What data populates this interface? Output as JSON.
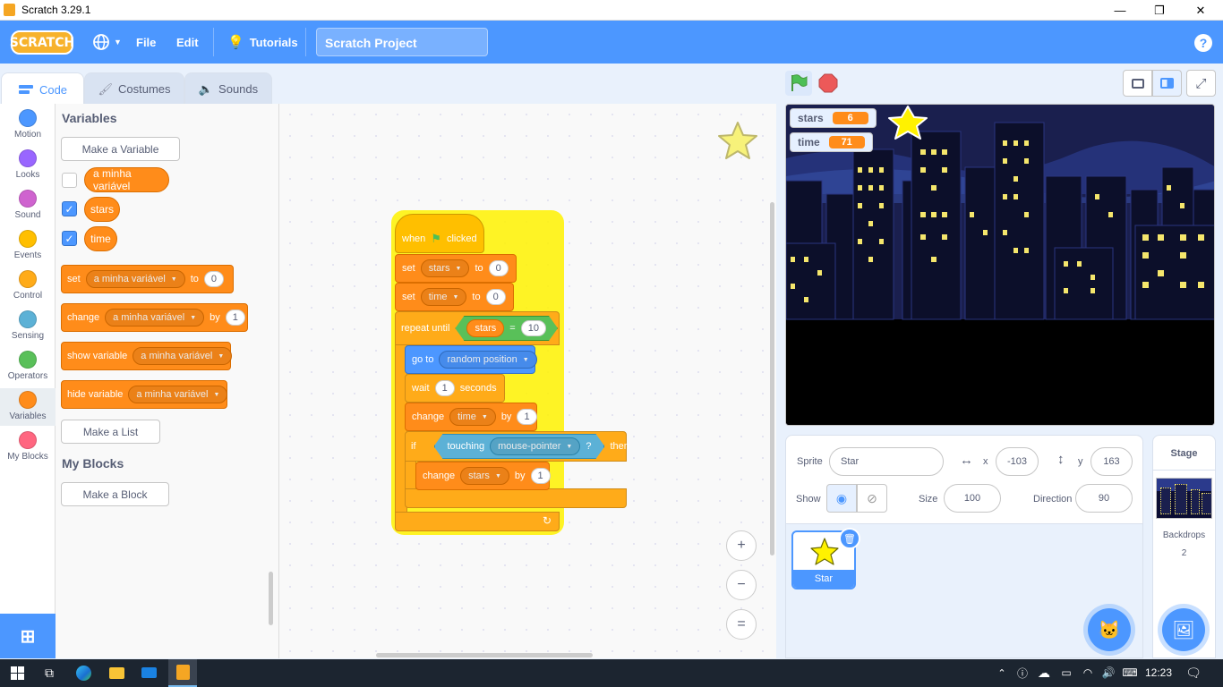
{
  "window": {
    "title": "Scratch 3.29.1",
    "minimize": "—",
    "restore": "❐",
    "close": "✕"
  },
  "menubar": {
    "logo": "SCRATCH",
    "file": "File",
    "edit": "Edit",
    "tutorials": "Tutorials",
    "project_name": "Scratch Project",
    "help": "?"
  },
  "tabs": {
    "code": "Code",
    "costumes": "Costumes",
    "sounds": "Sounds"
  },
  "categories": [
    {
      "label": "Motion",
      "color": "#4c97ff"
    },
    {
      "label": "Looks",
      "color": "#9966ff"
    },
    {
      "label": "Sound",
      "color": "#cf63cf"
    },
    {
      "label": "Events",
      "color": "#ffbf00"
    },
    {
      "label": "Control",
      "color": "#ffab19"
    },
    {
      "label": "Sensing",
      "color": "#5cb1d6"
    },
    {
      "label": "Operators",
      "color": "#59c059"
    },
    {
      "label": "Variables",
      "color": "#ff8c1a"
    },
    {
      "label": "My Blocks",
      "color": "#ff6680"
    }
  ],
  "palette": {
    "variables_heading": "Variables",
    "make_variable": "Make a Variable",
    "vars": [
      "a minha variável",
      "stars",
      "time"
    ],
    "set_block": {
      "kw": "set",
      "var": "a minha variável",
      "to": "to",
      "val": "0"
    },
    "change_block": {
      "kw": "change",
      "var": "a minha variável",
      "by": "by",
      "val": "1"
    },
    "show_block": {
      "kw": "show variable",
      "var": "a minha variável"
    },
    "hide_block": {
      "kw": "hide variable",
      "var": "a minha variável"
    },
    "make_list": "Make a List",
    "myblocks_heading": "My Blocks",
    "make_block": "Make a Block"
  },
  "script": {
    "when": "when",
    "clicked": "clicked",
    "set1": {
      "kw": "set",
      "var": "stars",
      "to": "to",
      "val": "0"
    },
    "set2": {
      "kw": "set",
      "var": "time",
      "to": "to",
      "val": "0"
    },
    "repeat": {
      "kw": "repeat until",
      "var": "stars",
      "op": "=",
      "val": "10"
    },
    "goto": {
      "kw": "go to",
      "target": "random position"
    },
    "wait": {
      "kw": "wait",
      "val": "1",
      "unit": "seconds"
    },
    "change_time": {
      "kw": "change",
      "var": "time",
      "by": "by",
      "val": "1"
    },
    "if": {
      "kw": "if",
      "touching": "touching",
      "target": "mouse-pointer",
      "q": "?",
      "then": "then"
    },
    "change_stars": {
      "kw": "change",
      "var": "stars",
      "by": "by",
      "val": "1"
    },
    "zoom_in": "+",
    "zoom_out": "−",
    "zoom_reset": "="
  },
  "stage": {
    "monitors": [
      {
        "name": "stars",
        "value": "6"
      },
      {
        "name": "time",
        "value": "71"
      }
    ]
  },
  "sprite_info": {
    "sprite_label": "Sprite",
    "sprite_name": "Star",
    "x_label": "x",
    "x": "-103",
    "y_label": "y",
    "y": "163",
    "show_label": "Show",
    "size_label": "Size",
    "size": "100",
    "direction_label": "Direction",
    "direction": "90"
  },
  "sprites": [
    {
      "name": "Star"
    }
  ],
  "stage_panel": {
    "title": "Stage",
    "backdrops_label": "Backdrops",
    "backdrops_count": "2"
  },
  "taskbar": {
    "time": "12:23"
  }
}
